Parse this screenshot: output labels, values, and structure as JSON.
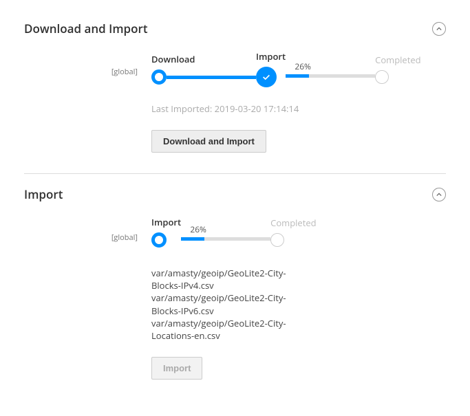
{
  "section1": {
    "title": "Download and Import",
    "scope": "[global]",
    "steps": {
      "download": "Download",
      "import": "Import",
      "completed": "Completed",
      "progress": "26%"
    },
    "last_imported": "Last Imported: 2019-03-20 17:14:14",
    "button": "Download and Import"
  },
  "section2": {
    "title": "Import",
    "scope": "[global]",
    "steps": {
      "import": "Import",
      "completed": "Completed",
      "progress": "26%"
    },
    "files": [
      "var/amasty/geoip/GeoLite2-City-Blocks-IPv4.csv",
      "var/amasty/geoip/GeoLite2-City-Blocks-IPv6.csv",
      "var/amasty/geoip/GeoLite2-City-Locations-en.csv"
    ],
    "button": "Import"
  }
}
